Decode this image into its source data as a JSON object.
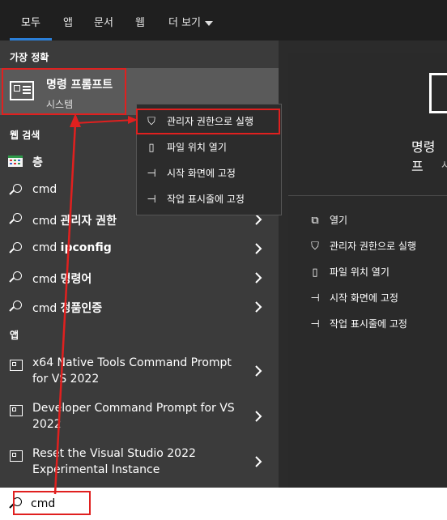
{
  "tabs": [
    {
      "label": "모두",
      "active": true
    },
    {
      "label": "앱"
    },
    {
      "label": "문서"
    },
    {
      "label": "웹"
    },
    {
      "label": "더 보기"
    }
  ],
  "best_match": {
    "section_label": "가장 정확",
    "title": "명령 프롬프트",
    "subtitle": "시스템",
    "icon": "terminal-app-icon"
  },
  "web_search": {
    "section_label": "웹 검색",
    "items": [
      {
        "prefix": "",
        "bold": "층",
        "icon": "calendar-thumbnail-icon",
        "arrow": false
      },
      {
        "prefix": "cmd",
        "bold": "",
        "icon": "search-icon",
        "arrow": false
      },
      {
        "prefix": "cmd ",
        "bold": "관리자 권한",
        "icon": "search-icon",
        "arrow": true
      },
      {
        "prefix": "cmd ",
        "bold": "ipconfig",
        "icon": "search-icon",
        "arrow": true
      },
      {
        "prefix": "cmd ",
        "bold": "명령어",
        "icon": "search-icon",
        "arrow": true
      },
      {
        "prefix": "cmd ",
        "bold": "정품인증",
        "icon": "search-icon",
        "arrow": true
      }
    ]
  },
  "apps": {
    "section_label": "앱",
    "items": [
      {
        "label": "x64 Native Tools Command Prompt for VS 2022"
      },
      {
        "label": "Developer Command Prompt for VS 2022"
      },
      {
        "label": "Reset the Visual Studio 2022 Experimental Instance"
      }
    ]
  },
  "context_menu": [
    {
      "label": "관리자 권한으로 실행",
      "icon": "shield-icon"
    },
    {
      "label": "파일 위치 열기",
      "icon": "folder-icon"
    },
    {
      "label": "시작 화면에 고정",
      "icon": "pin-icon"
    },
    {
      "label": "작업 표시줄에 고정",
      "icon": "pin-icon"
    }
  ],
  "right_panel": {
    "title": "명령 프",
    "subtitle": "시",
    "actions": [
      {
        "label": "열기",
        "icon": "open-icon"
      },
      {
        "label": "관리자 권한으로 실행",
        "icon": "shield-icon"
      },
      {
        "label": "파일 위치 열기",
        "icon": "folder-icon"
      },
      {
        "label": "시작 화면에 고정",
        "icon": "pin-icon"
      },
      {
        "label": "작업 표시줄에 고정",
        "icon": "pin-icon"
      }
    ]
  },
  "search": {
    "value": "cmd"
  },
  "colors": {
    "highlight": "#e0201f",
    "accent": "#2b7fd8"
  }
}
